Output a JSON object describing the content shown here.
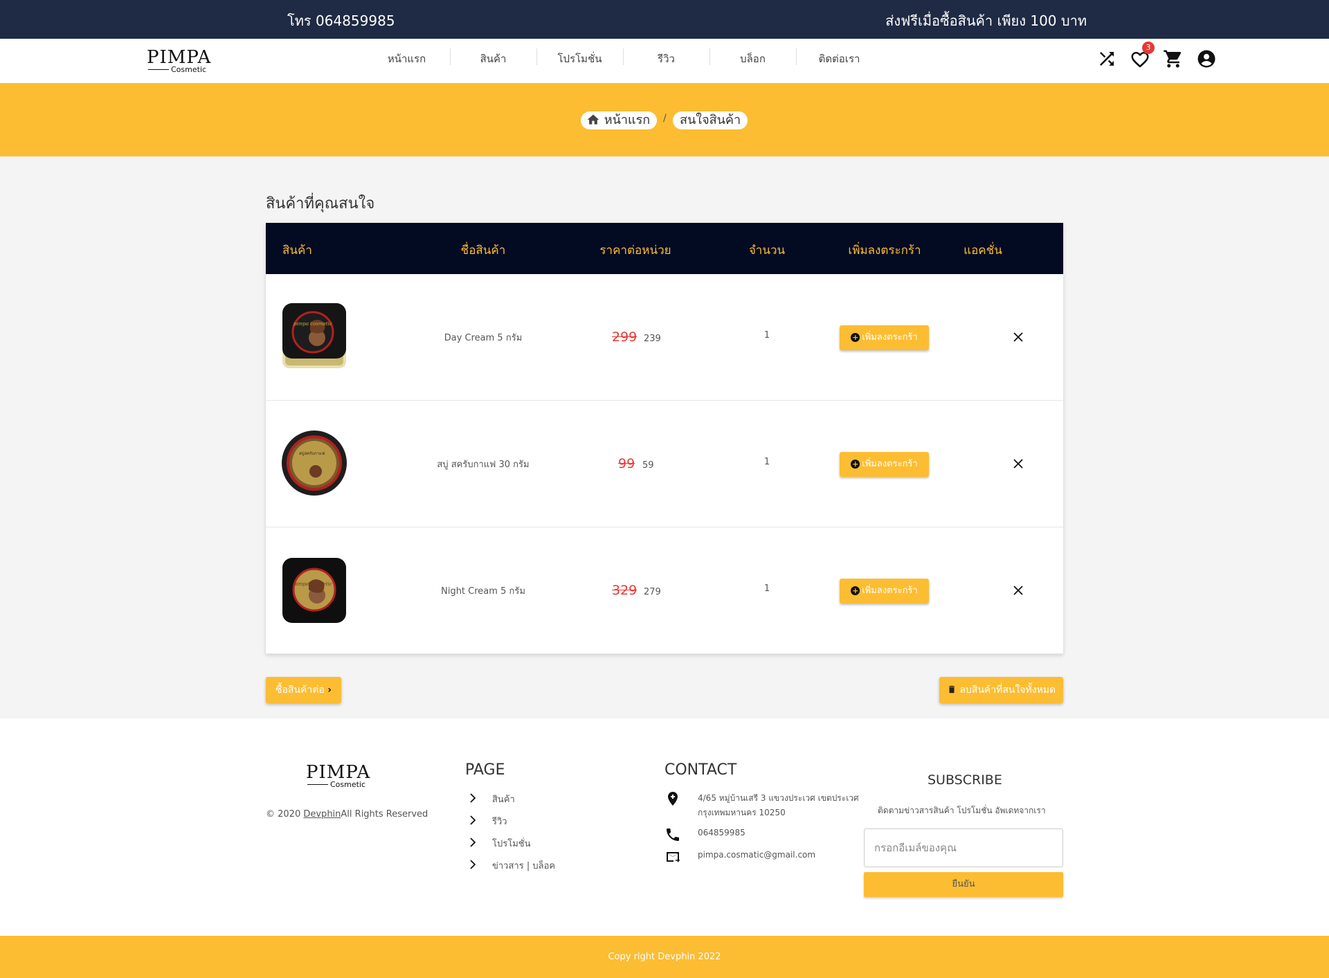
{
  "topbar": {
    "phone": "โทร 064859985",
    "promo": "ส่งฟรีเมื่อซื้อสินค้า เพียง 100 บาท"
  },
  "logo": {
    "brand": "PIMPA",
    "sub": "Cosmetic"
  },
  "nav": [
    "หน้าแรก",
    "สินค้า",
    "โปรโมชั่น",
    "รีวิว",
    "บล็อก",
    "ติดต่อเรา"
  ],
  "header_icons": {
    "wishlist_count": "3"
  },
  "breadcrumb": {
    "home": "หน้าแรก",
    "sep": "/",
    "current": "สนใจสินค้า"
  },
  "page_title": "สินค้าที่คุณสนใจ",
  "table": {
    "headers": [
      "สินค้า",
      "ชื่อสินค้า",
      "ราคาต่อหน่วย",
      "จำนวน",
      "เพิ่มลงตระกร้า",
      "แอคชั่น"
    ],
    "rows": [
      {
        "name": "Day Cream 5 กรัม",
        "old_price": "299",
        "price": "239",
        "qty": "1",
        "add": "เพิ่มลงตระกร้า"
      },
      {
        "name": "สบู่ สครับกาแฟ 30 กรัม",
        "old_price": "99",
        "price": "59",
        "qty": "1",
        "add": "เพิ่มลงตระกร้า"
      },
      {
        "name": "Night Cream 5 กรัม",
        "old_price": "329",
        "price": "279",
        "qty": "1",
        "add": "เพิ่มลงตระกร้า"
      }
    ]
  },
  "actions": {
    "continue": "ซื้อสินค้าต่อ",
    "clear_all": "ลบสินค้าที่สนใจทั้งหมด"
  },
  "footer": {
    "copyright_prefix": "© 2020 ",
    "copyright_link": "Devphin",
    "copyright_suffix": "All Rights Reserved",
    "page_head": "PAGE",
    "page_links": [
      "สินค้า",
      "รีวิว",
      "โปรโมชั่น",
      "ข่าวสาร | บล็อค"
    ],
    "contact_head": "CONTACT",
    "address_line1": "4/65 หมู่บ้านเสรี 3 แขวงประเวศ เขตประเวศ",
    "address_line2": "กรุงเทพมหานคร 10250",
    "phone": "064859985",
    "email": "pimpa.cosmatic@gmail.com",
    "subscribe_head": "SUBSCRIBE",
    "subscribe_text": "ติดตามข่าวสารสินค้า โปรโมชั่น อัพเดทจากเรา",
    "subscribe_placeholder": "กรอกอีเมล์ของคุณ",
    "subscribe_button": "ยืนยัน",
    "bottom": "Copy right Devphin 2022"
  },
  "colors": {
    "accent": "#fcbd32",
    "topbar": "#1f2a44",
    "table_head": "#030b22",
    "price_old": "#e53935"
  }
}
